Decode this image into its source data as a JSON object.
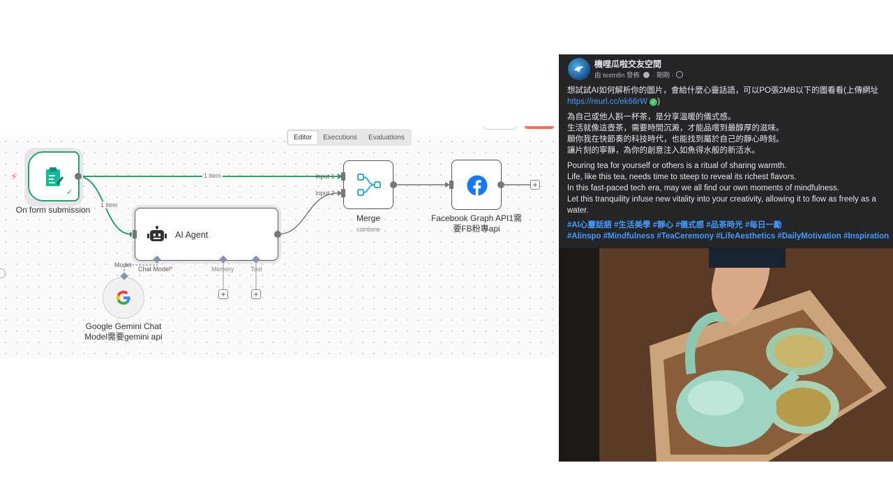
{
  "editor": {
    "tabs": [
      "Editor",
      "Executions",
      "Evaluations"
    ],
    "active_tab": "Editor"
  },
  "workflow": {
    "trigger": {
      "label": "On form submission"
    },
    "agent": {
      "label": "AI Agent",
      "ports": {
        "chat_model": "Chat Model",
        "required_mark": "*",
        "memory": "Memory",
        "tool": "Tool"
      }
    },
    "model_port_label": "Model",
    "gemini": {
      "label_line1": "Google Gemini Chat",
      "label_line2": "Model需要gemini api"
    },
    "merge": {
      "label": "Merge",
      "sublabel": "combine",
      "input1": "Input 1",
      "input2": "Input 2"
    },
    "facebook": {
      "label_line1": "Facebook Graph API1需",
      "label_line2": "要FB粉專api"
    },
    "edge_labels": {
      "trigger_to_merge": "1 item",
      "trigger_to_agent": "1 item"
    },
    "add_symbol": "+"
  },
  "post": {
    "page_name": "機哩瓜啦交友空間",
    "meta_by": "由 testn8n 發佈",
    "meta_time": "剛剛",
    "intro_line1": "想試試AI如何解析你的圖片，會給什麼心靈話語，可以PO張2MB以下的圖看看(上傳網址",
    "intro_link": "https://reurl.cc/ek66rW",
    "intro_close": ")",
    "zh_lines": [
      "為自己或他人斟一杯茶，是分享溫暖的儀式感。",
      "生活就像這壺茶，需要時間沉澱，才能品嚐到最醇厚的滋味。",
      "願你我在快節奏的科技時代，也能找到屬於自己的靜心時刻。",
      "讓片刻的寧靜，為你的創意注入如魚得水般的新活水。"
    ],
    "en_lines": [
      "Pouring tea for yourself or others is a ritual of sharing warmth.",
      "Life, like this tea, needs time to steep to reveal its richest flavors.",
      "In this fast-paced tech era, may we all find our own moments of mindfulness.",
      "Let this tranquility infuse new vitality into your creativity, allowing it to flow as freely as a",
      "water."
    ],
    "hashtags_zh": "#AI心靈話語 #生活美學 #靜心 #儀式感 #品茶時光 #每日一勵",
    "hashtags_en": "#AIinspo #Mindfulness #TeaCeremony #LifeAesthetics #DailyMotivation #Inspiration"
  },
  "colors": {
    "success_green": "#2e9e6a",
    "n8n_orange": "#ff6d5a",
    "facebook_blue": "#1877f2",
    "merge_teal": "#3aa9c6",
    "fb_bg": "#242526",
    "link_blue": "#4599ff"
  }
}
